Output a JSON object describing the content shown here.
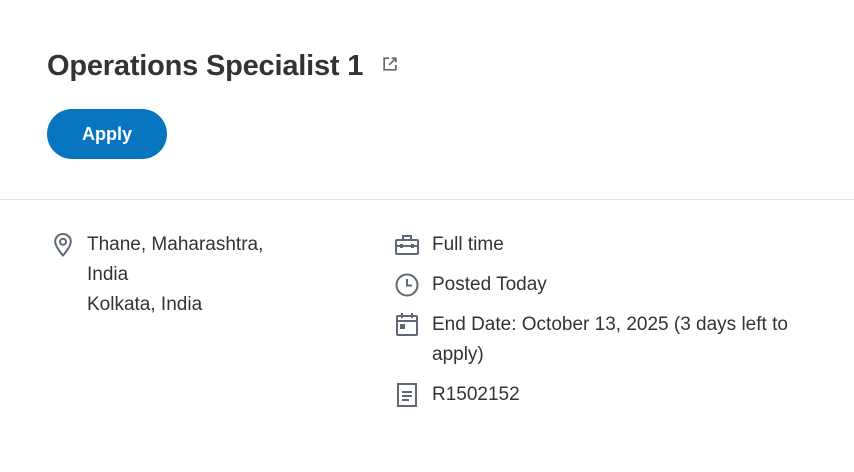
{
  "job": {
    "title": "Operations Specialist 1",
    "apply_label": "Apply"
  },
  "icons": {
    "external_link": "external-link-icon",
    "location": "location-pin-icon",
    "time_type": "briefcase-icon",
    "posted": "clock-icon",
    "end_date": "calendar-icon",
    "requisition": "document-icon"
  },
  "colors": {
    "accent": "#0875c1",
    "text": "#333333",
    "icon": "#5f6a75",
    "divider": "#dfe2e5"
  },
  "details": {
    "locations": [
      "Thane, Maharashtra,",
      "India",
      "Kolkata, India"
    ],
    "time_type": "Full time",
    "posted": "Posted Today",
    "end_date": "End Date: October 13, 2025 (3 days left to apply)",
    "requisition_id": "R1502152"
  }
}
